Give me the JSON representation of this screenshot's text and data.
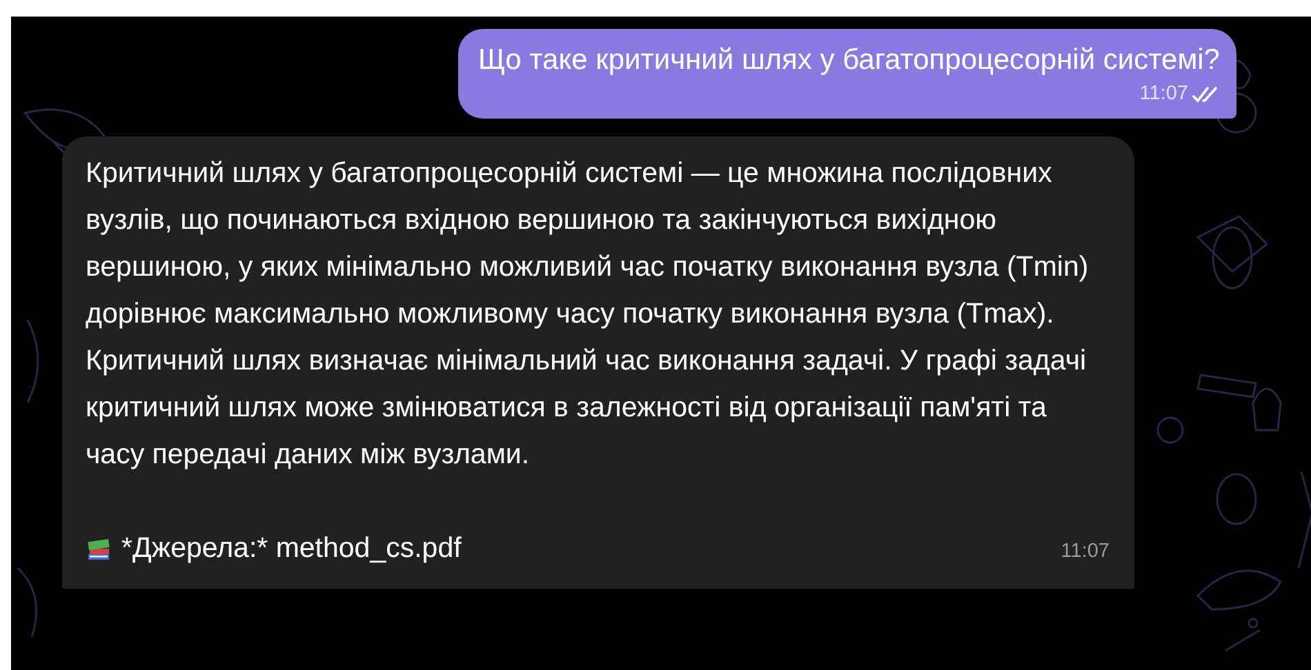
{
  "messages": [
    {
      "kind": "outgoing",
      "text": "Що таке критичний шлях у багатопроцесорній системі?",
      "time": "11:07",
      "read": true
    },
    {
      "kind": "incoming",
      "text": "Критичний шлях у багатопроцесорній системі — це множина послідовних вузлів, що починаються вхідною вершиною та закінчуються вихідною вершиною, у яких мінімально можливий час початку виконання вузла (Tmin) дорівнює максимально можливому часу початку виконання вузла (Tmax). Критичний шлях визначає мінімальний час виконання задачі. У графі задачі критичний шлях може змінюватися в залежності від організації пам'яті та часу передачі даних між вузлами.",
      "source": "*Джерела:* method_cs.pdf",
      "time": "11:07"
    }
  ]
}
